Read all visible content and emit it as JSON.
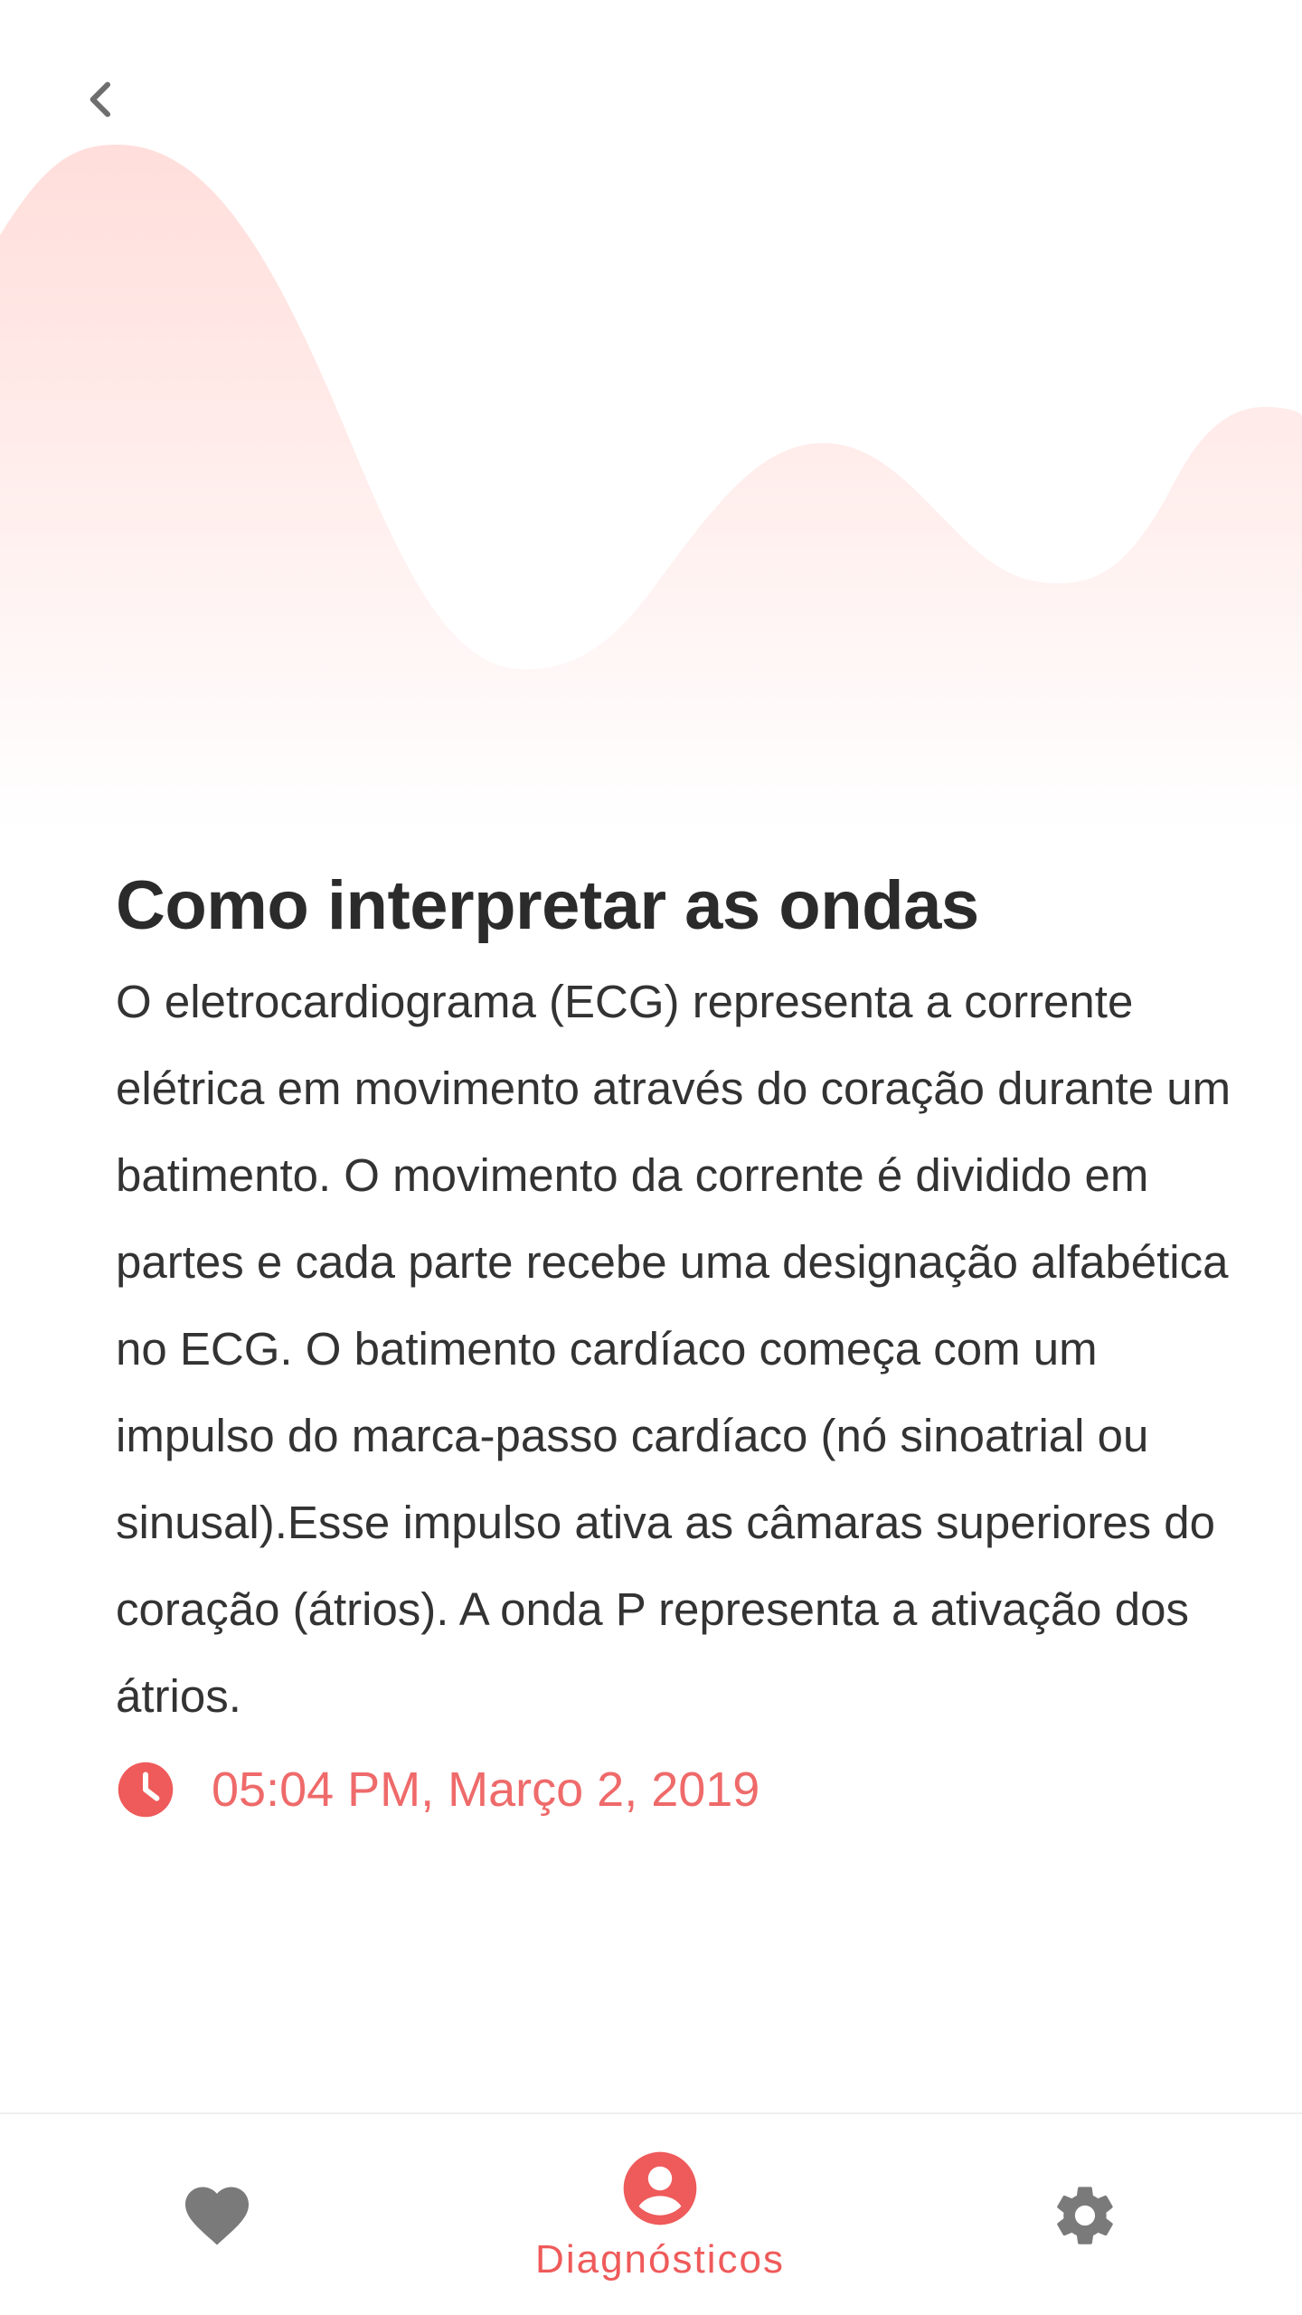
{
  "header": {
    "back_icon": "chevron-left-icon",
    "wave_color_top": "#ffe1df",
    "wave_color_bottom": "#ffffff"
  },
  "article": {
    "title": "Como interpretar as ondas",
    "body": "O eletrocardiograma (ECG) representa a corrente elétrica em movimento através do coração durante um batimento. O movimento da corrente é dividido em partes e cada parte recebe uma designação alfabética no ECG. O batimento cardíaco começa com um impulso do marca-passo cardíaco (nó sinoatrial ou sinusal).Esse impulso ativa as câmaras superiores do coração (átrios). A onda P representa a ativação dos átrios.",
    "timestamp": "05:04 PM, Março 2, 2019",
    "timestamp_icon": "clock-icon"
  },
  "bottom_nav": {
    "items": [
      {
        "icon": "heart-icon",
        "label": "",
        "active": false
      },
      {
        "icon": "account-circle-icon",
        "label": "Diagnósticos",
        "active": true
      },
      {
        "icon": "gear-icon",
        "label": "",
        "active": false
      }
    ]
  },
  "colors": {
    "accent": "#ef5a5a",
    "inactive_icon": "#7a7a7a",
    "title_text": "#2b2b2b",
    "body_text": "#333333"
  }
}
